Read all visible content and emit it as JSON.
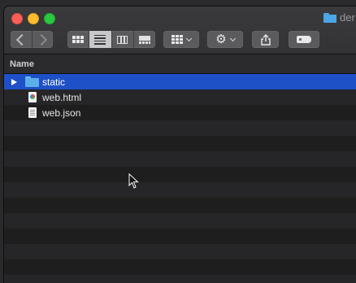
{
  "window": {
    "title": "der"
  },
  "toolbar": {
    "back": "back",
    "forward": "forward",
    "views": [
      "icon-view",
      "list-view",
      "column-view",
      "cover-flow-view"
    ],
    "active_view": 1,
    "group": "group-by",
    "action": "action-menu",
    "share": "share",
    "tags": "tags"
  },
  "list": {
    "column_header": "Name",
    "items": [
      {
        "name": "static",
        "kind": "folder",
        "selected": true
      },
      {
        "name": "web.html",
        "kind": "html-file",
        "selected": false
      },
      {
        "name": "web.json",
        "kind": "json-file",
        "selected": false
      }
    ]
  },
  "colors": {
    "selection": "#1e50c8",
    "folder": "#5aaee9"
  }
}
